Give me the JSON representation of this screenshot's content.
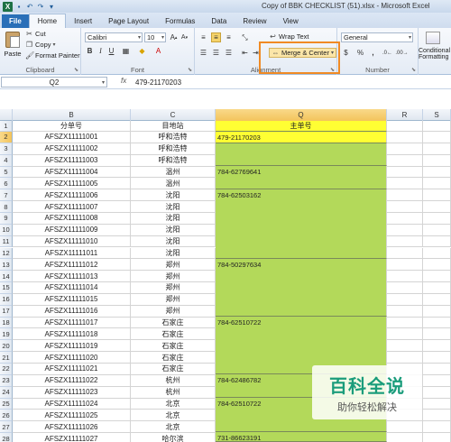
{
  "window": {
    "title": "Copy of BBK CHECKLIST (51).xlsx - Microsoft Excel",
    "app_icon": "X"
  },
  "tabs": [
    {
      "label": "File"
    },
    {
      "label": "Home"
    },
    {
      "label": "Insert"
    },
    {
      "label": "Page Layout"
    },
    {
      "label": "Formulas"
    },
    {
      "label": "Data"
    },
    {
      "label": "Review"
    },
    {
      "label": "View"
    }
  ],
  "ribbon": {
    "clipboard": {
      "paste": "Paste",
      "cut": "Cut",
      "copy": "Copy",
      "format_painter": "Format Painter",
      "label": "Clipboard"
    },
    "font": {
      "name": "Calibri",
      "size": "10",
      "label": "Font"
    },
    "alignment": {
      "wrap_text": "Wrap Text",
      "merge_center": "Merge & Center",
      "label": "Alignment"
    },
    "number": {
      "format": "General",
      "currency": "$",
      "percent": "%",
      "comma": ",",
      "label": "Number"
    },
    "styles": {
      "conditional": "Conditional",
      "formatting": "Formatting"
    }
  },
  "formula_bar": {
    "name_box": "Q2",
    "fx": "fx",
    "content": "479-21170203"
  },
  "columns": {
    "B": "B",
    "C": "C",
    "Q": "Q",
    "R": "R",
    "S": "S"
  },
  "headers": {
    "b": "分单号",
    "c": "目地站",
    "q": "主单号"
  },
  "rows": [
    {
      "n": "2",
      "b": "AFSZX11111001",
      "c": "呼和浩特"
    },
    {
      "n": "3",
      "b": "AFSZX11111002",
      "c": "呼和浩特"
    },
    {
      "n": "4",
      "b": "AFSZX11111003",
      "c": "呼和浩特"
    },
    {
      "n": "5",
      "b": "AFSZX11111004",
      "c": "温州"
    },
    {
      "n": "6",
      "b": "AFSZX11111005",
      "c": "温州"
    },
    {
      "n": "7",
      "b": "AFSZX11111006",
      "c": "沈阳"
    },
    {
      "n": "8",
      "b": "AFSZX11111007",
      "c": "沈阳"
    },
    {
      "n": "9",
      "b": "AFSZX11111008",
      "c": "沈阳"
    },
    {
      "n": "10",
      "b": "AFSZX11111009",
      "c": "沈阳"
    },
    {
      "n": "11",
      "b": "AFSZX11111010",
      "c": "沈阳"
    },
    {
      "n": "12",
      "b": "AFSZX11111011",
      "c": "沈阳"
    },
    {
      "n": "13",
      "b": "AFSZX11111012",
      "c": "郑州"
    },
    {
      "n": "14",
      "b": "AFSZX11111013",
      "c": "郑州"
    },
    {
      "n": "15",
      "b": "AFSZX11111014",
      "c": "郑州"
    },
    {
      "n": "16",
      "b": "AFSZX11111015",
      "c": "郑州"
    },
    {
      "n": "17",
      "b": "AFSZX11111016",
      "c": "郑州"
    },
    {
      "n": "18",
      "b": "AFSZX11111017",
      "c": "石家庄"
    },
    {
      "n": "19",
      "b": "AFSZX11111018",
      "c": "石家庄"
    },
    {
      "n": "20",
      "b": "AFSZX11111019",
      "c": "石家庄"
    },
    {
      "n": "21",
      "b": "AFSZX11111020",
      "c": "石家庄"
    },
    {
      "n": "22",
      "b": "AFSZX11111021",
      "c": "石家庄"
    },
    {
      "n": "23",
      "b": "AFSZX11111022",
      "c": "杭州"
    },
    {
      "n": "24",
      "b": "AFSZX11111023",
      "c": "杭州"
    },
    {
      "n": "25",
      "b": "AFSZX11111024",
      "c": "北京"
    },
    {
      "n": "26",
      "b": "AFSZX11111025",
      "c": "北京"
    },
    {
      "n": "27",
      "b": "AFSZX11111026",
      "c": "北京"
    },
    {
      "n": "28",
      "b": "AFSZX11111027",
      "c": "哈尔滨"
    }
  ],
  "q_values": {
    "q2": "479-21170203",
    "q5": "784-62769641",
    "q7": "784-62503162",
    "q13": "784-50297634",
    "q18": "784-62510722",
    "q23": "784-62486782",
    "q25": "784-62510722",
    "q28": "731-86623191"
  },
  "header_row_number": "1",
  "watermark": {
    "main": "百科全说",
    "sub": "助你轻松解决"
  }
}
